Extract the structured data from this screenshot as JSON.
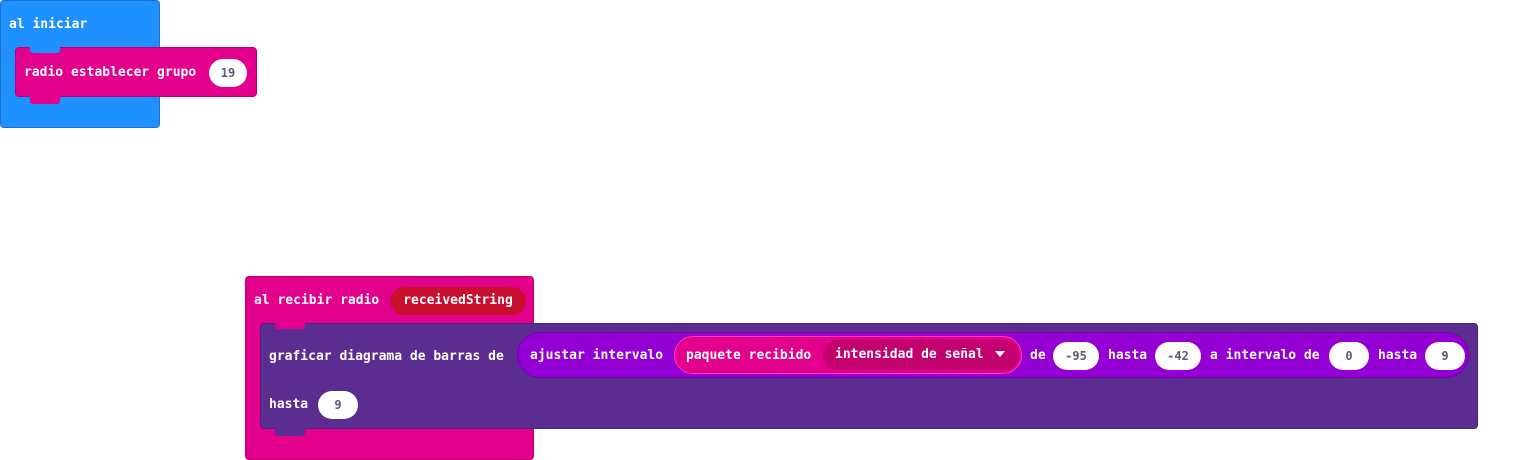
{
  "colors": {
    "basic": "#1e90ff",
    "basic_border": "#1872cc",
    "radio": "#e3008c",
    "radio_border": "#b6006f",
    "radio_dark": "#c2006e",
    "variable": "#c8102e",
    "led_purple": "#5c2d91",
    "led_border": "#48247a",
    "math": "#9400d3",
    "pill_text": "#575e75"
  },
  "on_start": {
    "label": "al iniciar",
    "set_group": {
      "label": "radio establecer grupo",
      "value": "19"
    }
  },
  "on_received": {
    "label": "al recibir radio",
    "variable": "receivedString",
    "plot": {
      "label": "graficar diagrama de barras de",
      "map": {
        "label": "ajustar intervalo",
        "packet": {
          "label": "paquete recibido",
          "property": "intensidad de señal",
          "dropdown_icon": "caret-down-icon"
        },
        "from_label": "de",
        "from_low": "-95",
        "to_label": "hasta",
        "from_high": "-42",
        "to_range_label": "a intervalo de",
        "to_low": "0",
        "to_high_label": "hasta",
        "to_high": "9"
      },
      "up_to_label": "hasta",
      "up_to": "9"
    }
  }
}
